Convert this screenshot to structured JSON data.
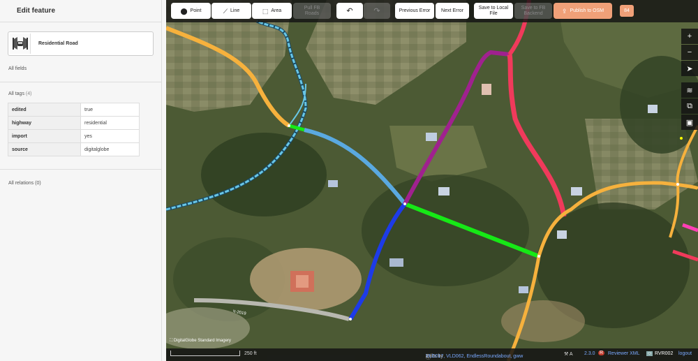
{
  "sidebar": {
    "title": "Edit feature",
    "preset_name": "Residential Road",
    "all_fields": "All fields",
    "all_tags_label": "All tags",
    "all_tags_count": "(4)",
    "tags": [
      {
        "key": "edited",
        "value": "true"
      },
      {
        "key": "highway",
        "value": "residential"
      },
      {
        "key": "import",
        "value": "yes"
      },
      {
        "key": "source",
        "value": "digitalglobe"
      }
    ],
    "all_relations": "All relations (0)"
  },
  "toolbar": {
    "point": "Point",
    "line": "Line",
    "area": "Area",
    "pull_fb_line1": "Pull FB",
    "pull_fb_line2": "Roads",
    "undo_icon": "undo-icon",
    "redo_icon": "redo-icon",
    "previous_error": "Previous Error",
    "next_error": "Next Error",
    "save_local_line1": "Save to Local",
    "save_local_line2": "File",
    "save_fb_line1": "Save to FB",
    "save_fb_line2": "Backend",
    "publish": "Publish to OSM",
    "publish_count": "84"
  },
  "map": {
    "road_label": "ঘ-2019",
    "imagery_label": "DigitalGlobe Standard Imagery",
    "colors": {
      "orange": "#f6b13d",
      "cyan_path": "#69c7e6",
      "blue_road": "#5aa9e0",
      "dark_blue": "#1d3be8",
      "green": "#16e916",
      "purple": "#a0218f",
      "red": "#f03a5b",
      "pink": "#ff3fb5",
      "publish": "#f0a078"
    }
  },
  "footer": {
    "scale": "250 ft",
    "edits_by": "Edits by",
    "editors": "VLD017, VLD062, EndlessRoundabout, gww",
    "version": "2.3.0",
    "reviewer": "Reviewer XML",
    "user": "RVR002",
    "logout": "logout"
  }
}
